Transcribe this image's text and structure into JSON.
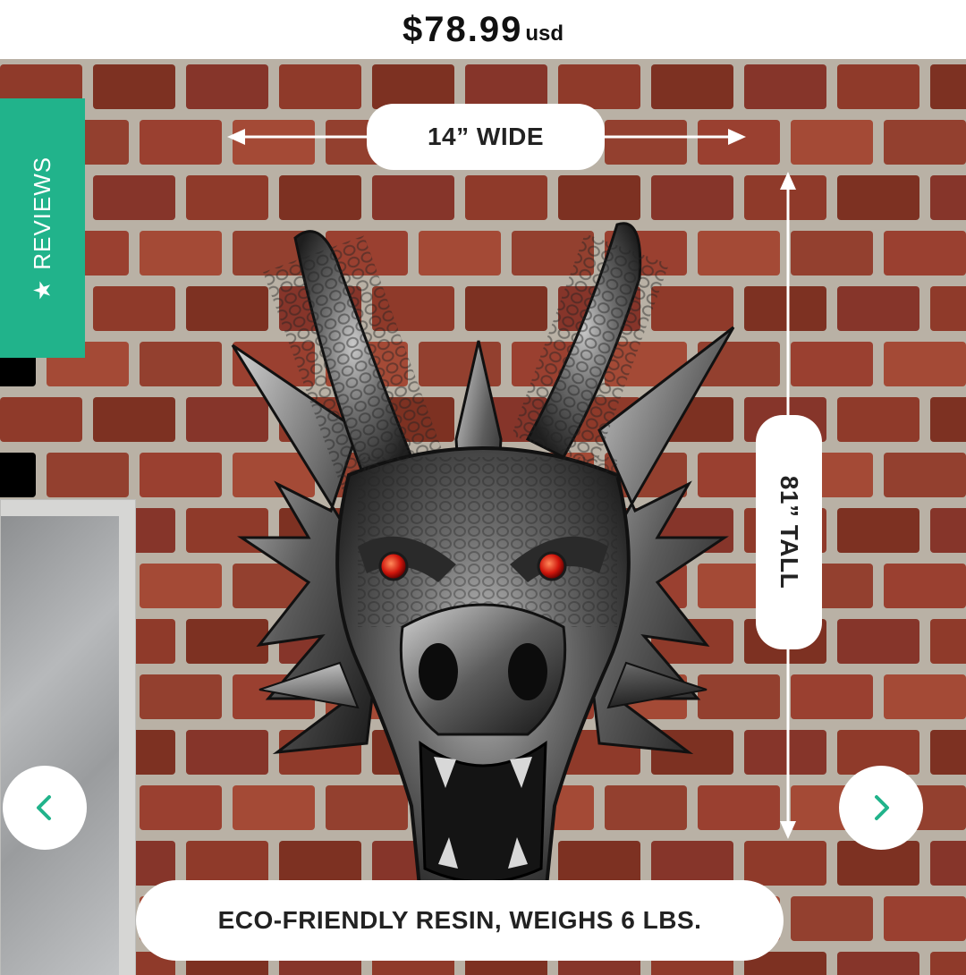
{
  "header": {
    "price": "$78.99",
    "currency": "usd"
  },
  "reviews_tab": {
    "label": "REVIEWS",
    "icon": "star-icon"
  },
  "product_image": {
    "dimension_wide_label": "14” WIDE",
    "dimension_tall_label": "81” TALL",
    "material_label": "ECO-FRIENDLY RESIN, WEIGHS 6 LBS."
  },
  "navigation": {
    "prev_icon": "chevron-left-icon",
    "next_icon": "chevron-right-icon"
  },
  "colors": {
    "accent": "#21b38b",
    "brick": "#8f3a2a",
    "mortar": "#b9b1a5",
    "pill": "#ffffff",
    "text": "#111111"
  }
}
